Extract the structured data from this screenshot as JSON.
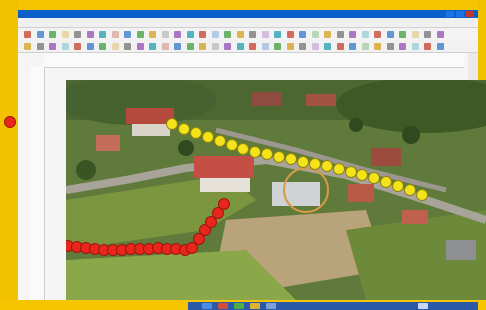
{
  "window": {
    "title": "",
    "menu_items": [
      "",
      "",
      "",
      "",
      "",
      "",
      "",
      ""
    ]
  },
  "markers": {
    "yellow_color": "#f4e21a",
    "red_color": "#e8261c",
    "yellow_count": 22,
    "red_count": 20
  },
  "colors": {
    "frame": "#f6c400",
    "titlebar": "#0b5fc9",
    "taskbar": "#2a5aa8"
  },
  "icons": {
    "red_pin": "map-pin-red-icon",
    "yellow_pin": "map-pin-yellow-icon"
  }
}
